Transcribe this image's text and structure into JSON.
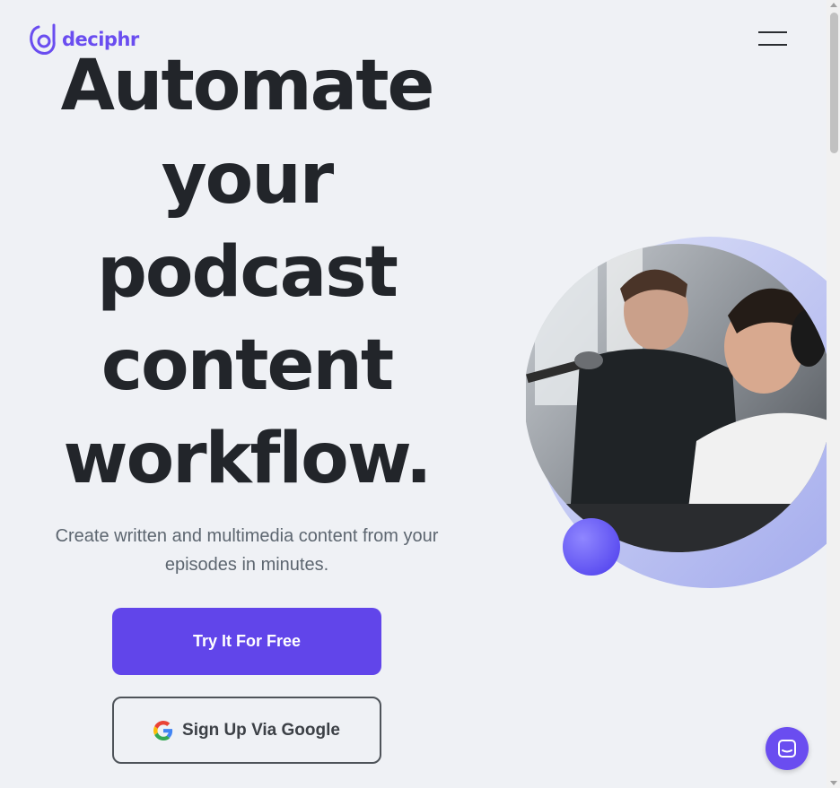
{
  "header": {
    "logo_text": "deciphr",
    "menu_icon": "hamburger-icon"
  },
  "hero": {
    "headline_lines": [
      "Automate",
      "your",
      "podcast",
      "content",
      "workflow."
    ],
    "subtitle": "Create written and multimedia content from your episodes in minutes.",
    "primary_cta": "Try It For Free",
    "google_cta": "Sign Up Via Google"
  },
  "widgets": {
    "chat_icon": "chat-icon"
  },
  "colors": {
    "brand": "#6a4df0",
    "primary_button": "#6145ea",
    "background": "#eff1f5",
    "headline": "#22252a"
  }
}
